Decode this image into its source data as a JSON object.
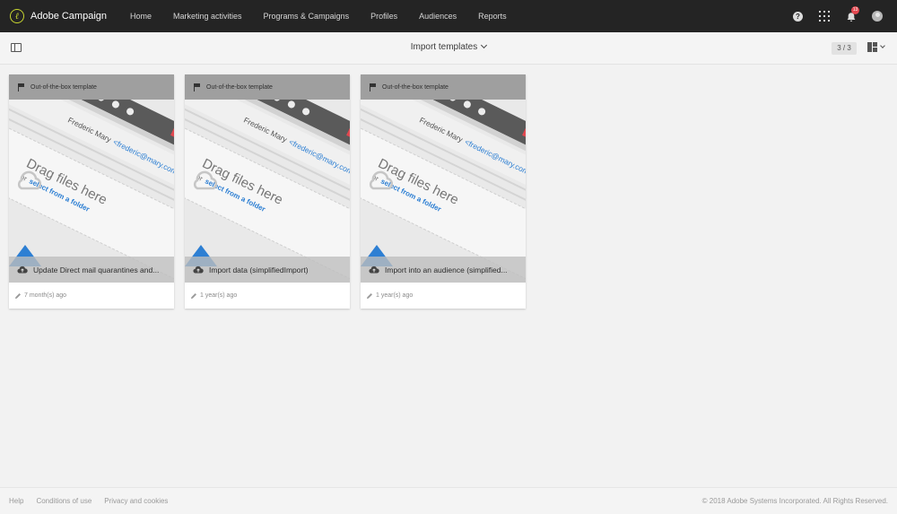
{
  "app": {
    "brand_name": "Adobe Campaign",
    "logo_glyph": "ℓ"
  },
  "nav": [
    {
      "label": "Home"
    },
    {
      "label": "Marketing activities"
    },
    {
      "label": "Programs & Campaigns"
    },
    {
      "label": "Profiles"
    },
    {
      "label": "Audiences"
    },
    {
      "label": "Reports"
    }
  ],
  "top_actions": {
    "help_glyph": "?",
    "notification_count": "13"
  },
  "toolbar": {
    "title": "Import templates",
    "count": "3 / 3"
  },
  "cards": [
    {
      "header": "Out-of-the-box template",
      "name": "Update Direct mail quarantines and...",
      "time": "7 month(s) ago"
    },
    {
      "header": "Out-of-the-box template",
      "name": "Import data (simplifiedImport)",
      "time": "1 year(s) ago"
    },
    {
      "header": "Out-of-the-box template",
      "name": "Import into an audience (simplified...",
      "time": "1 year(s) ago"
    }
  ],
  "thumbnail": {
    "contact_name": "Frederic Mary",
    "contact_email": "<frederic@mary.com>",
    "drag_text": "Drag files here",
    "or_text": "or",
    "select_link": "select from a folder"
  },
  "footer": {
    "links": [
      {
        "label": "Help"
      },
      {
        "label": "Conditions of use"
      },
      {
        "label": "Privacy and cookies"
      }
    ],
    "copyright": "© 2018 Adobe Systems Incorporated. All Rights Reserved."
  },
  "colors": {
    "topbar": "#242424",
    "accent_blue": "#2d7fd3",
    "badge_red": "#e34850",
    "logo_green": "#c8d630"
  }
}
